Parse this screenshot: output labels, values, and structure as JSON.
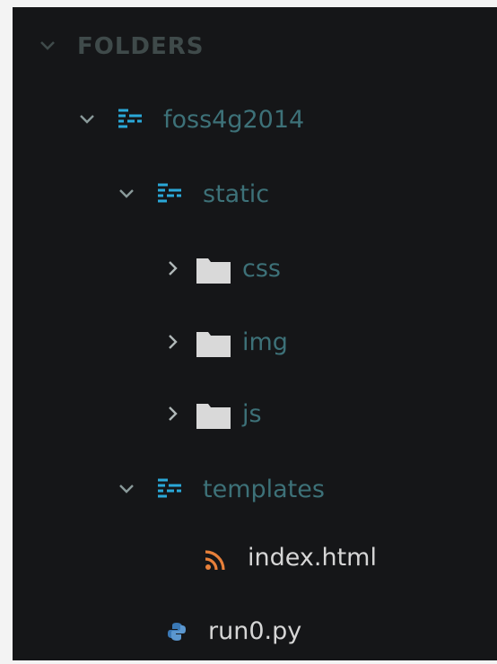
{
  "sidebar": {
    "section_title": "FOLDERS",
    "tree": {
      "root": {
        "label": "foss4g2014",
        "expanded": true,
        "icon": "open-folder-icon"
      },
      "static": {
        "label": "static",
        "expanded": true,
        "icon": "open-folder-icon"
      },
      "css": {
        "label": "css",
        "expanded": false,
        "icon": "folder-icon"
      },
      "img": {
        "label": "img",
        "expanded": false,
        "icon": "folder-icon"
      },
      "js": {
        "label": "js",
        "expanded": false,
        "icon": "folder-icon"
      },
      "templates": {
        "label": "templates",
        "expanded": true,
        "icon": "open-folder-icon"
      },
      "index_html": {
        "label": "index.html",
        "icon": "rss-icon"
      },
      "run0_py": {
        "label": "run0.py",
        "icon": "python-icon"
      }
    }
  },
  "colors": {
    "background": "#151618",
    "section_title": "#3f4a4a",
    "folder_label": "#3d7178",
    "file_label": "#d6d6d6",
    "open_folder_icon": "#2aa8d8",
    "closed_folder_icon": "#d9d9d9",
    "rss_icon": "#e8803a",
    "python_icon": "#3a78b5"
  }
}
